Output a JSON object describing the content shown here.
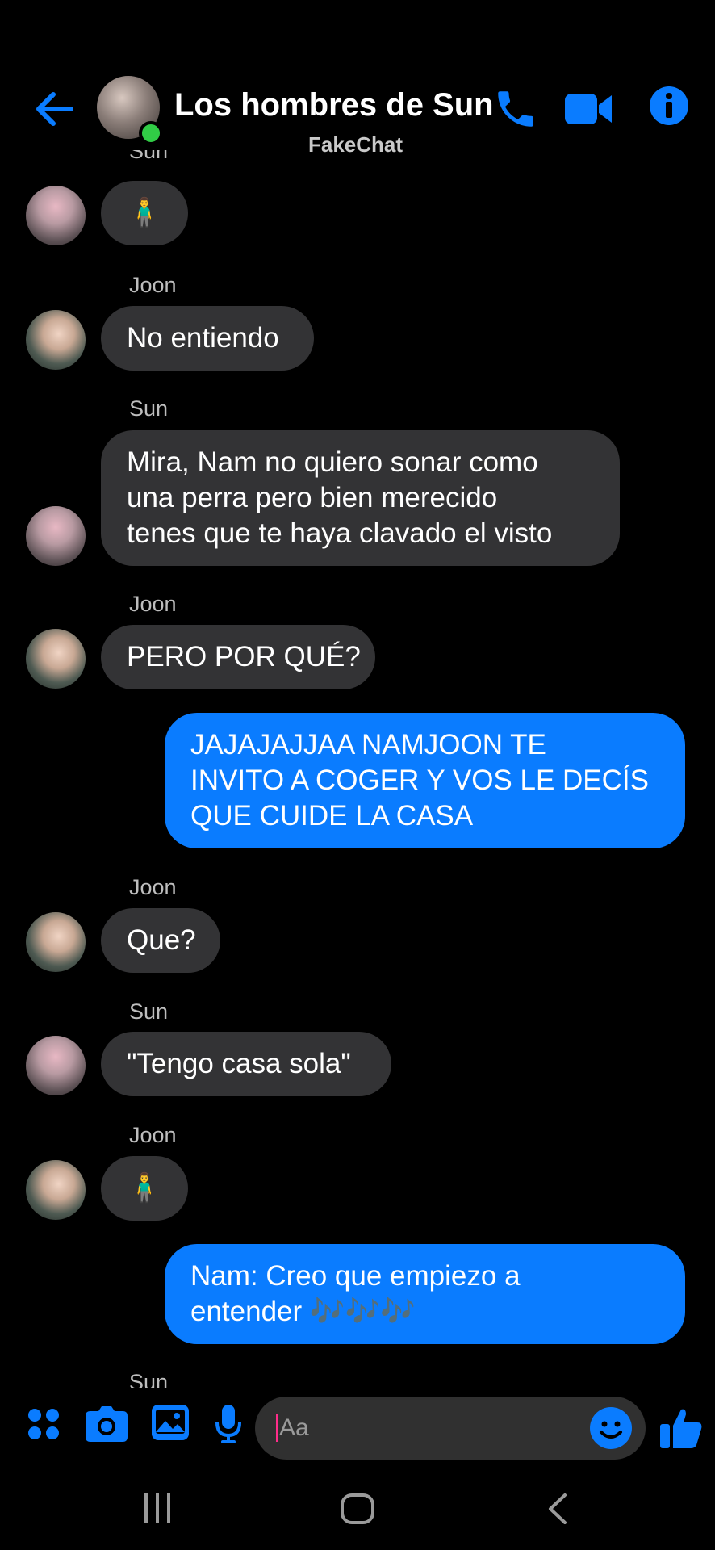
{
  "header": {
    "title": "Los hombres de Sun",
    "subtitle": "FakeChat"
  },
  "messages": [
    {
      "id": "m0",
      "direction": "in",
      "sender": "Sun",
      "text": "🧍‍♂️"
    },
    {
      "id": "m1",
      "direction": "in",
      "sender": "Joon",
      "text": "No entiendo"
    },
    {
      "id": "m2",
      "direction": "in",
      "sender": "Sun",
      "lines": [
        "Mira, Nam no quiero sonar como",
        "una perra pero bien merecido",
        "tenes que te haya clavado el visto"
      ]
    },
    {
      "id": "m3",
      "direction": "in",
      "sender": "Joon",
      "text": "PERO POR QUÉ?"
    },
    {
      "id": "m4",
      "direction": "out",
      "lines": [
        "JAJAJAJJAA NAMJOON TE",
        "INVITO A COGER Y VOS LE DECÍS",
        "QUE CUIDE LA CASA"
      ]
    },
    {
      "id": "m5",
      "direction": "in",
      "sender": "Joon",
      "text": "Que?"
    },
    {
      "id": "m6",
      "direction": "in",
      "sender": "Sun",
      "text": "\"Tengo casa sola\""
    },
    {
      "id": "m7",
      "direction": "in",
      "sender": "Joon",
      "text": "🧍‍♂️"
    },
    {
      "id": "m8",
      "direction": "out",
      "lines": [
        "Nam: Creo que empiezo a",
        "entender 🎶🎶🎶"
      ]
    }
  ],
  "bottom_sender": "Sun",
  "composer": {
    "placeholder": "Aa"
  },
  "icons": {
    "header": [
      "back-arrow-icon",
      "phone-icon",
      "video-camera-icon",
      "info-icon"
    ],
    "toolbar": [
      "apps-grid-icon",
      "camera-icon",
      "image-icon",
      "microphone-icon",
      "smile-icon",
      "thumbs-up-icon"
    ],
    "nav": [
      "recents-icon",
      "home-icon",
      "back-icon"
    ]
  },
  "colors": {
    "accent": "#0a7cff",
    "incoming_bubble": "#333335",
    "online": "#31cc46",
    "background": "#000000"
  }
}
